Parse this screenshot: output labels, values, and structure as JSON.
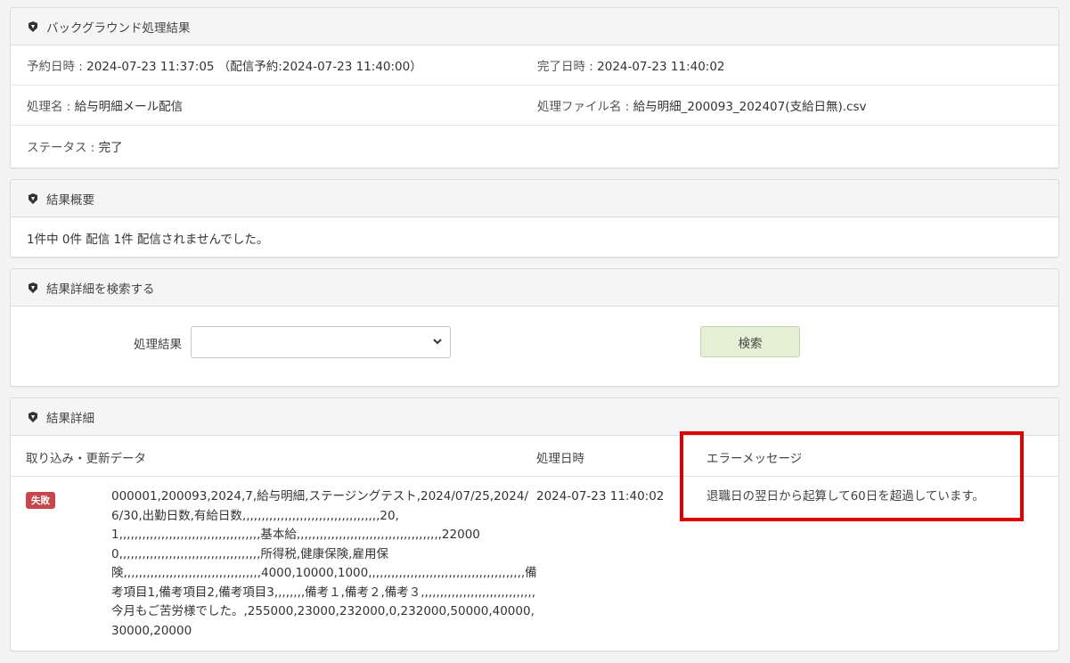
{
  "panel1": {
    "title": "バックグラウンド処理結果",
    "reserved_label": "予約日時 : ",
    "reserved_value": "2024-07-23 11:37:05 （配信予約:2024-07-23 11:40:00）",
    "completed_label": "完了日時 : ",
    "completed_value": "2024-07-23 11:40:02",
    "process_label": "処理名 : ",
    "process_value": "給与明細メール配信",
    "file_label": "処理ファイル名 : ",
    "file_value": "給与明細_200093_202407(支給日無).csv",
    "status_label": "ステータス : ",
    "status_value": "完了"
  },
  "panel2": {
    "title": "結果概要",
    "summary": "1件中 0件 配信 1件 配信されませんでした。"
  },
  "panel3": {
    "title": "結果詳細を検索する",
    "filter_label": "処理結果",
    "filter_value": "",
    "search_button": "検索"
  },
  "panel4": {
    "title": "結果詳細",
    "col_data": "取り込み・更新データ",
    "col_date": "処理日時",
    "col_error": "エラーメッセージ",
    "rows": [
      {
        "status": "失敗",
        "data": "000001,200093,2024,7,給与明細,ステージングテスト,2024/07/25,2024/6/30,出勤日数,有給日数,,,,,,,,,,,,,,,,,,,,,,,,,,,,,,,,,,,,20,1,,,,,,,,,,,,,,,,,,,,,,,,,,,,,,,,,,,,,基本給,,,,,,,,,,,,,,,,,,,,,,,,,,,,,,,,,,,,,,22000 0,,,,,,,,,,,,,,,,,,,,,,,,,,,,,,,,,,,,,所得税,健康保険,雇用保険,,,,,,,,,,,,,,,,,,,,,,,,,,,,,,,,,,,,4000,10000,1000,,,,,,,,,,,,,,,,,,,,,,,,,,,,,,,,,,,,,,,,,備考項目1,備考項目2,備考項目3,,,,,,,,備考１,備考２,備考３,,,,,,,,,,,,,,,,,,,,,,,,,,,,,,今月もご苦労様でした。,255000,23000,232000,0,232000,50000,40000,30000,20000",
        "date": "2024-07-23 11:40:02",
        "error": "退職日の翌日から起算して60日を超過しています。"
      }
    ]
  },
  "colors": {
    "badge": "#c9474a",
    "highlight": "#e00000",
    "search_button_bg": "#e5efd3"
  },
  "icons": {
    "panel_icon": "brand-icon",
    "select_chevron": "chevron-down-icon"
  }
}
